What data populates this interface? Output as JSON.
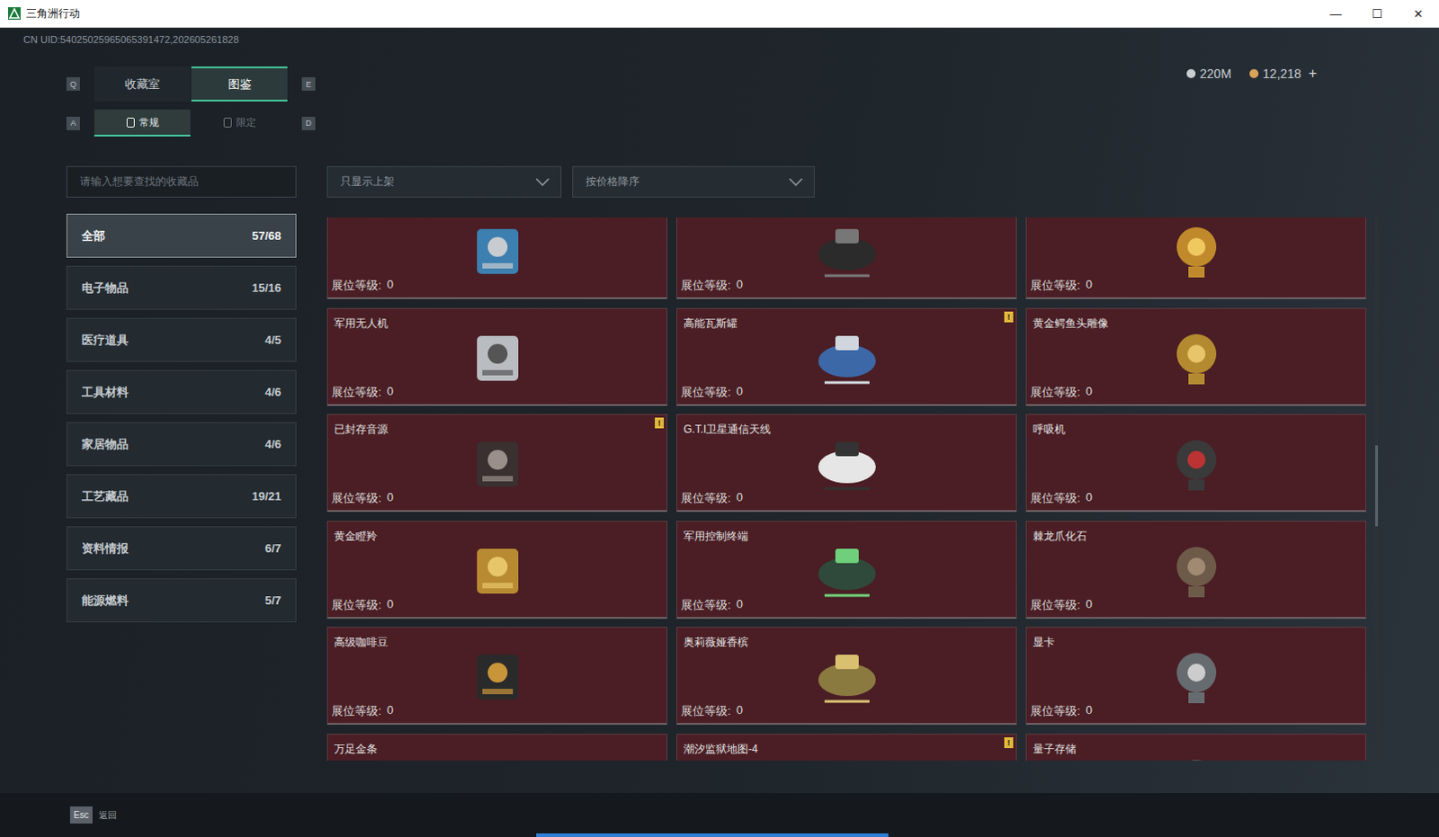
{
  "window": {
    "title": "三角洲行动",
    "controls": [
      "—",
      "☐",
      "✕"
    ]
  },
  "uid": "CN UID:54025025965065391472,202605261828",
  "currencies": [
    {
      "value": "220M",
      "color": "#c9ced3"
    },
    {
      "value": "12,218",
      "color": "#d9a35a"
    }
  ],
  "add_button": "+",
  "tabs": {
    "prev_key": "Q",
    "next_key": "E",
    "items": [
      {
        "label": "收藏室",
        "selected": false
      },
      {
        "label": "图鉴",
        "selected": true
      }
    ]
  },
  "subtabs": {
    "prev_key": "A",
    "next_key": "D",
    "items": [
      {
        "label": "常规",
        "selected": true
      },
      {
        "label": "限定",
        "selected": false
      }
    ]
  },
  "search": {
    "placeholder": "请输入想要查找的收藏品"
  },
  "filters": [
    {
      "label": "只显示上架"
    },
    {
      "label": "按价格降序"
    }
  ],
  "sidebar": {
    "items": [
      {
        "label": "全部",
        "count": "57/68",
        "selected": true
      },
      {
        "label": "电子物品",
        "count": "15/16",
        "selected": false
      },
      {
        "label": "医疗道具",
        "count": "4/5",
        "selected": false
      },
      {
        "label": "工具材料",
        "count": "4/6",
        "selected": false
      },
      {
        "label": "家居物品",
        "count": "4/6",
        "selected": false
      },
      {
        "label": "工艺藏品",
        "count": "19/21",
        "selected": false
      },
      {
        "label": "资料情报",
        "count": "6/7",
        "selected": false
      },
      {
        "label": "能源燃料",
        "count": "5/7",
        "selected": false
      }
    ]
  },
  "grid": {
    "level_label": "展位等级:",
    "alert_mark": "!",
    "cards": [
      {
        "name": "",
        "level": "0",
        "alert": false
      },
      {
        "name": "",
        "level": "0",
        "alert": false
      },
      {
        "name": "",
        "level": "0",
        "alert": false
      },
      {
        "name": "军用无人机",
        "level": "0",
        "alert": false
      },
      {
        "name": "高能瓦斯罐",
        "level": "0",
        "alert": true
      },
      {
        "name": "黄金鳄鱼头雕像",
        "level": "0",
        "alert": false
      },
      {
        "name": "已封存音源",
        "level": "0",
        "alert": true
      },
      {
        "name": "G.T.I卫星通信天线",
        "level": "0",
        "alert": false
      },
      {
        "name": "呼吸机",
        "level": "0",
        "alert": false
      },
      {
        "name": "黄金瞪羚",
        "level": "0",
        "alert": false
      },
      {
        "name": "军用控制终端",
        "level": "0",
        "alert": false
      },
      {
        "name": "棘龙爪化石",
        "level": "0",
        "alert": false
      },
      {
        "name": "高级咖啡豆",
        "level": "0",
        "alert": false
      },
      {
        "name": "奥莉薇娅香槟",
        "level": "0",
        "alert": false
      },
      {
        "name": "显卡",
        "level": "0",
        "alert": false
      },
      {
        "name": "万足金条",
        "level": null,
        "alert": false
      },
      {
        "name": "潮汐监狱地图-4",
        "level": null,
        "alert": true
      },
      {
        "name": "量子存储",
        "level": null,
        "alert": false
      }
    ]
  },
  "scrollbar": {
    "level": 0.42
  },
  "footer": {
    "key": "Esc",
    "label": "返回"
  }
}
